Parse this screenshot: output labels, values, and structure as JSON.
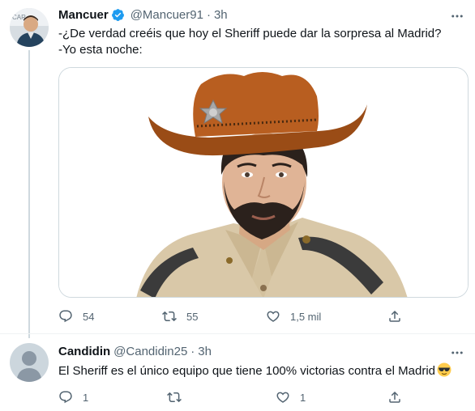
{
  "tweet1": {
    "name": "Mancuer",
    "handle": "@Mancuer91",
    "separator": "·",
    "time": "3h",
    "text": "-¿De verdad creéis que hoy el Sheriff puede dar la sorpresa al Madrid?\n-Yo esta noche:",
    "actions": {
      "replies": "54",
      "retweets": "55",
      "likes": "1,5 mil"
    },
    "verified": true
  },
  "tweet2": {
    "name": "Candidin",
    "handle": "@Candidin25",
    "separator": "·",
    "time": "3h",
    "text": "El Sheriff es el único equipo que tiene 100% victorias contra el Madrid",
    "actions": {
      "replies": "1",
      "retweets": "",
      "likes": "1"
    }
  },
  "colors": {
    "accent": "#1d9bf0",
    "muted": "#536471",
    "border": "#cfd9de"
  }
}
